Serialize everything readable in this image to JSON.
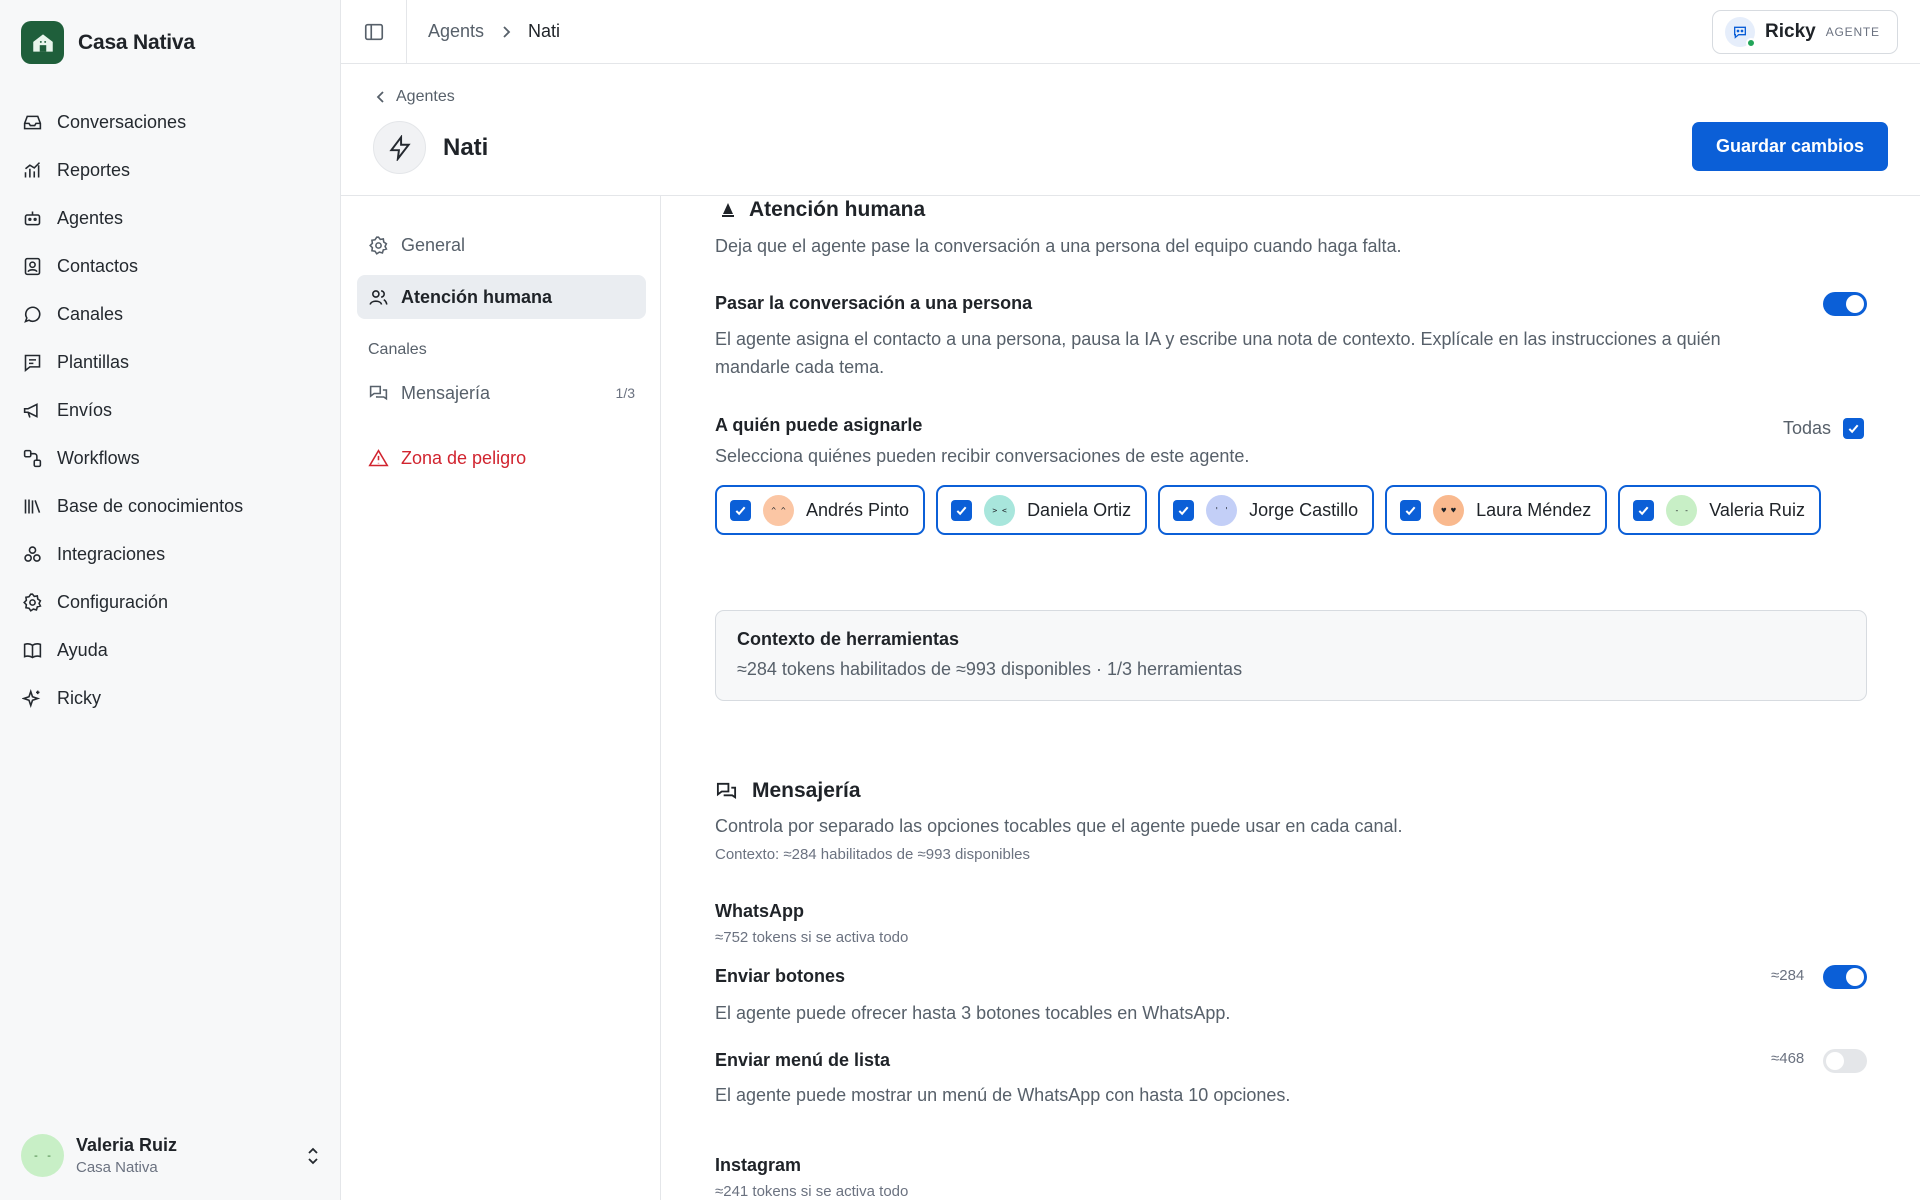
{
  "brand": {
    "name": "Casa Nativa"
  },
  "nav": [
    {
      "label": "Conversaciones",
      "icon": "inbox-icon"
    },
    {
      "label": "Reportes",
      "icon": "chart-icon"
    },
    {
      "label": "Agentes",
      "icon": "bot-icon"
    },
    {
      "label": "Contactos",
      "icon": "contact-icon"
    },
    {
      "label": "Canales",
      "icon": "chat-icon"
    },
    {
      "label": "Plantillas",
      "icon": "template-icon"
    },
    {
      "label": "Envíos",
      "icon": "megaphone-icon"
    },
    {
      "label": "Workflows",
      "icon": "workflow-icon"
    },
    {
      "label": "Base de conocimientos",
      "icon": "library-icon"
    },
    {
      "label": "Integraciones",
      "icon": "integrations-icon"
    },
    {
      "label": "Configuración",
      "icon": "gear-icon"
    },
    {
      "label": "Ayuda",
      "icon": "book-icon"
    },
    {
      "label": "Ricky",
      "icon": "sparkles-icon"
    }
  ],
  "user": {
    "name": "Valeria Ruiz",
    "org": "Casa Nativa"
  },
  "breadcrumb": {
    "parent": "Agents",
    "current": "Nati"
  },
  "agent_chip": {
    "name": "Ricky",
    "role": "AGENTE"
  },
  "header": {
    "back": "Agentes",
    "title": "Nati",
    "save": "Guardar cambios"
  },
  "subnav": {
    "general": "General",
    "human": "Atención humana",
    "group": "Canales",
    "messaging": "Mensajería",
    "messaging_count": "1/3",
    "danger": "Zona de peligro"
  },
  "human": {
    "title": "Atención humana",
    "desc": "Deja que el agente pase la conversación a una persona del equipo cuando haga falta.",
    "handoff_label": "Pasar la conversación a una persona",
    "handoff_on": true,
    "handoff_desc_1": "El agente asigna el contacto a una persona, pausa la IA y escribe una nota de contexto. Explícale en las instrucciones a quién",
    "handoff_desc_2": "mandarle cada tema.",
    "assign_label": "A quién puede asignarle",
    "all_label": "Todas",
    "assign_desc": "Selecciona quiénes pueden recibir conversaciones de este agente.",
    "people": [
      {
        "name": "Andrés Pinto",
        "color": "#fbc6a4",
        "face": "^ ^"
      },
      {
        "name": "Daniela Ortiz",
        "color": "#a8e6dc",
        "face": "> <"
      },
      {
        "name": "Jorge Castillo",
        "color": "#c3cff7",
        "face": "' '"
      },
      {
        "name": "Laura Méndez",
        "color": "#f9b98e",
        "face": "♥ ♥"
      },
      {
        "name": "Valeria Ruiz",
        "color": "#c8efc6",
        "face": "- -"
      }
    ]
  },
  "tools": {
    "title": "Contexto de herramientas",
    "desc": "≈284 tokens habilitados de ≈993 disponibles · 1/3 herramientas"
  },
  "messaging": {
    "title": "Mensajería",
    "desc": "Controla por separado las opciones tocables que el agente puede usar en cada canal.",
    "context": "Contexto: ≈284 habilitados de ≈993 disponibles",
    "whatsapp": {
      "name": "WhatsApp",
      "tokens": "≈752 tokens si se activa todo",
      "buttons_label": "Enviar botones",
      "buttons_tokens": "≈284",
      "buttons_on": true,
      "buttons_desc": "El agente puede ofrecer hasta 3 botones tocables en WhatsApp.",
      "list_label": "Enviar menú de lista",
      "list_tokens": "≈468",
      "list_on": false,
      "list_desc": "El agente puede mostrar un menú de WhatsApp con hasta 10 opciones."
    },
    "instagram": {
      "name": "Instagram",
      "tokens": "≈241 tokens si se activa todo"
    }
  },
  "colors": {
    "accent": "#0b5fd7",
    "brand": "#1f5f3b",
    "danger": "#d1242f"
  }
}
